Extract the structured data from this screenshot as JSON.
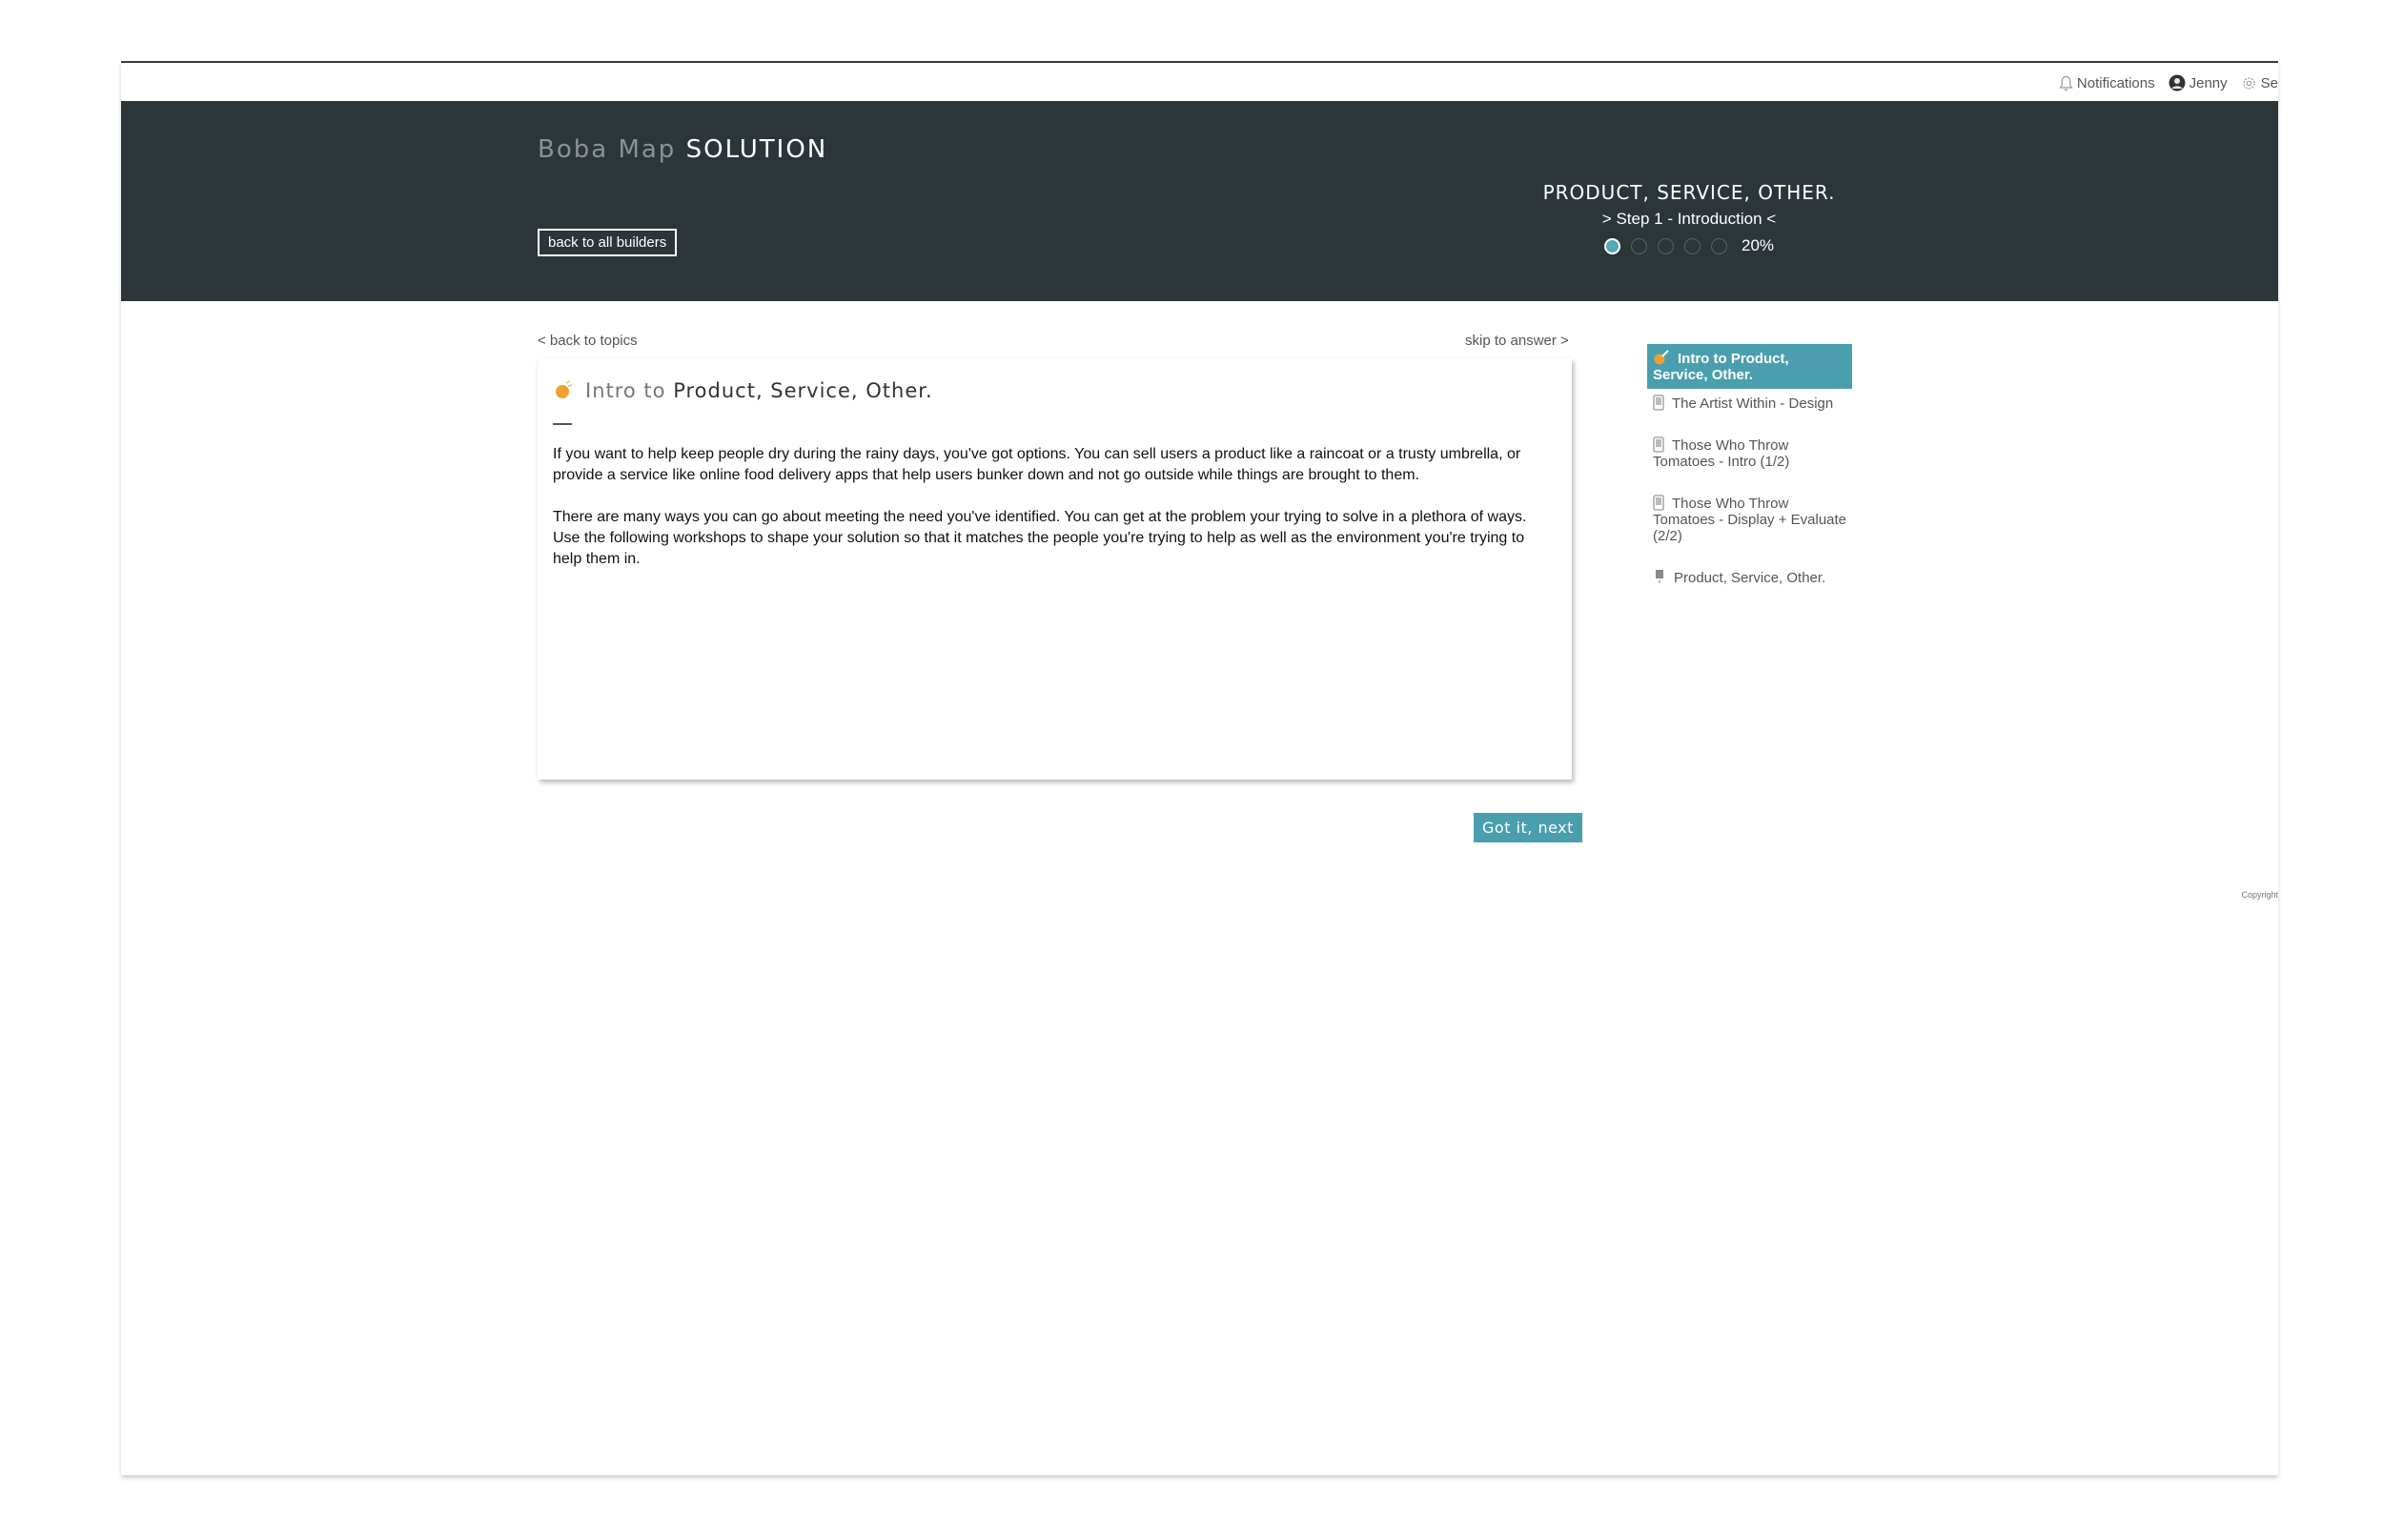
{
  "topnav": {
    "notifications": "Notifications",
    "user": "Jenny",
    "settings": "Se"
  },
  "header": {
    "brand_light": "Boba Map",
    "brand_bold": "SOLUTION",
    "back_button": "back to all builders",
    "progress_title": "PRODUCT, SERVICE, OTHER.",
    "progress_step": "> Step 1 - Introduction <",
    "progress_percent": "20%",
    "progress_value": 0.2,
    "progress_steps_total": 5,
    "progress_steps_done": 1
  },
  "content": {
    "back_link": "< back to topics",
    "skip_link": "skip to answer >",
    "card_title_light": "Intro to",
    "card_title_bold": "Product, Service, Other.",
    "paragraphs": [
      "If you want to help keep people dry during the rainy days, you've got options. You can sell users a product like a raincoat or a trusty umbrella, or provide a service like online food delivery apps that help users bunker down and not go outside while things are brought to them.",
      "There are many ways you can go about meeting the need you've identified. You can get at the problem your trying to solve in a plethora of ways. Use the following workshops to shape your solution so that it matches the people you're trying to help as well as the environment you're trying to help them in."
    ],
    "next_button": "Got it, next"
  },
  "sidebar": {
    "items": [
      {
        "label": "Intro to Product, Service, Other.",
        "icon": "paintbrush-icon",
        "active": true
      },
      {
        "label": "The Artist Within - Design",
        "icon": "phone-icon",
        "active": false
      },
      {
        "label": "Those Who Throw Tomatoes - Intro (1/2)",
        "icon": "phone-icon",
        "active": false
      },
      {
        "label": "Those Who Throw Tomatoes - Display + Evaluate (2/2)",
        "icon": "phone-icon",
        "active": false
      },
      {
        "label": "Product, Service, Other.",
        "icon": "flag-icon",
        "active": false
      }
    ]
  },
  "footer": {
    "copyright": "Copyright"
  },
  "colors": {
    "header_bg": "#2c3639",
    "accent": "#4a9fae",
    "orange": "#f0a030"
  }
}
